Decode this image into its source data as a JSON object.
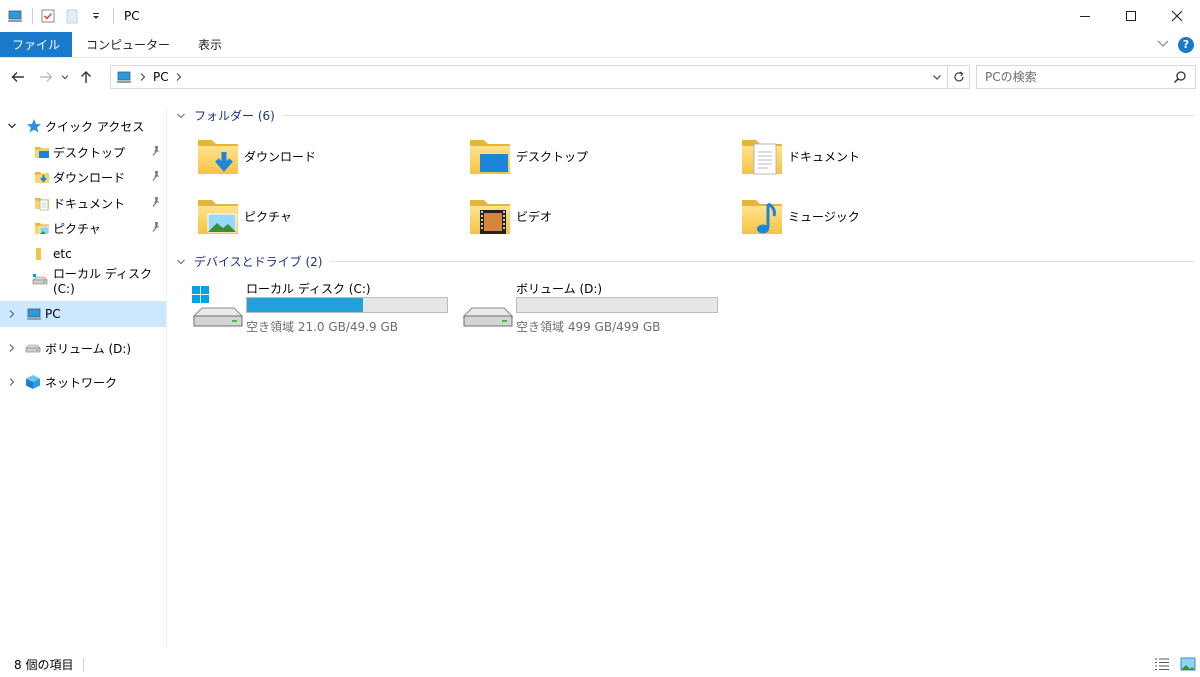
{
  "window": {
    "title": "PC"
  },
  "ribbon": {
    "tabs": [
      {
        "label": "ファイル",
        "active": true
      },
      {
        "label": "コンピューター",
        "active": false
      },
      {
        "label": "表示",
        "active": false
      }
    ],
    "help_label": "?"
  },
  "address": {
    "breadcrumb": "PC"
  },
  "search": {
    "placeholder": "PCの検索"
  },
  "sidebar": {
    "items": [
      {
        "label": "クイック アクセス",
        "icon": "star-icon"
      },
      {
        "label": "デスクトップ",
        "icon": "desktop-folder-icon",
        "pinned": true
      },
      {
        "label": "ダウンロード",
        "icon": "download-folder-icon",
        "pinned": true
      },
      {
        "label": "ドキュメント",
        "icon": "documents-folder-icon",
        "pinned": true
      },
      {
        "label": "ピクチャ",
        "icon": "pictures-folder-icon",
        "pinned": true
      },
      {
        "label": "etc",
        "icon": "folder-icon"
      },
      {
        "label": "ローカル ディスク (C:)",
        "icon": "local-disk-icon"
      },
      {
        "label": "PC",
        "icon": "pc-icon",
        "selected": true
      },
      {
        "label": "ボリューム (D:)",
        "icon": "drive-icon"
      },
      {
        "label": "ネットワーク",
        "icon": "network-icon"
      }
    ]
  },
  "groups": {
    "folders_header": "フォルダー (6)",
    "devices_header": "デバイスとドライブ (2)"
  },
  "folders": [
    {
      "label": "ダウンロード",
      "icon": "download-folder-icon"
    },
    {
      "label": "デスクトップ",
      "icon": "desktop-folder-icon"
    },
    {
      "label": "ドキュメント",
      "icon": "documents-folder-icon"
    },
    {
      "label": "ピクチャ",
      "icon": "pictures-folder-icon"
    },
    {
      "label": "ビデオ",
      "icon": "videos-folder-icon"
    },
    {
      "label": "ミュージック",
      "icon": "music-folder-icon"
    }
  ],
  "drives": [
    {
      "name": "ローカル ディスク (C:)",
      "free_text": "空き領域 21.0 GB/49.9 GB",
      "used_fraction": 0.579,
      "icon": "windows-drive-icon"
    },
    {
      "name": "ボリューム (D:)",
      "free_text": "空き領域 499 GB/499 GB",
      "used_fraction": 0.0,
      "icon": "drive-icon"
    }
  ],
  "status": {
    "item_count": "8 個の項目"
  },
  "colors": {
    "accent": "#1979ca",
    "selection": "#cce8ff",
    "bar_fill": "#26a0da",
    "group_header": "#1e3287"
  }
}
